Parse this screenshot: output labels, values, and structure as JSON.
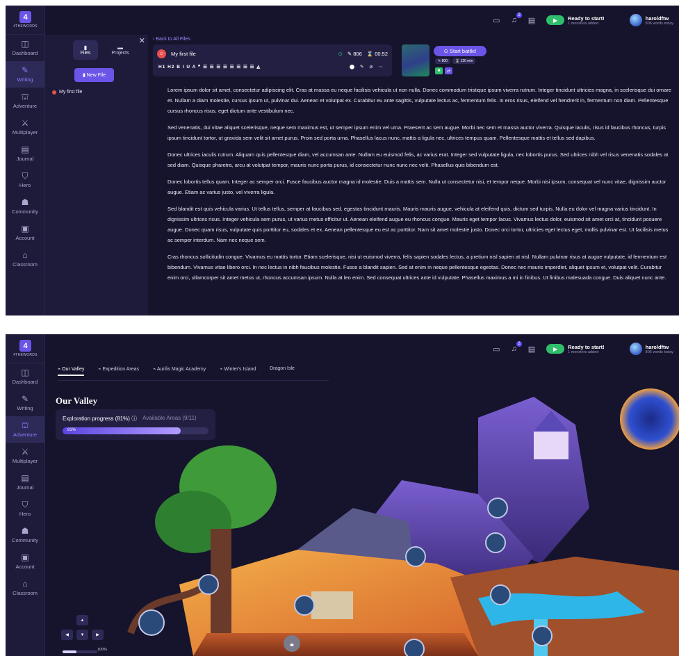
{
  "brand": {
    "logo_num": "4",
    "logo_text": "4THEWORDS"
  },
  "nav": [
    {
      "label": "Dashboard",
      "icon": "dashboard-icon"
    },
    {
      "label": "Writing",
      "icon": "pen-icon"
    },
    {
      "label": "Adventure",
      "icon": "adventure-icon"
    },
    {
      "label": "Multiplayer",
      "icon": "swords-icon"
    },
    {
      "label": "Journal",
      "icon": "journal-icon"
    },
    {
      "label": "Hero",
      "icon": "shield-icon"
    },
    {
      "label": "Community",
      "icon": "community-icon"
    },
    {
      "label": "Account",
      "icon": "account-icon"
    },
    {
      "label": "Classroom",
      "icon": "graduation-cap-icon"
    }
  ],
  "topbar": {
    "notif_count": "2",
    "ready_title": "Ready to start!",
    "ready_sub": "1 monsters added",
    "user_name": "haroldftw",
    "user_sub": "806 words today"
  },
  "files": {
    "tab_files": "Files",
    "tab_projects": "Projects",
    "new_file": "New File",
    "items": [
      "My first file"
    ]
  },
  "editor": {
    "back": "Back to All Files",
    "file_name": "My first file",
    "word_count": "806",
    "timer": "00:52",
    "battle_label": "Start battle!",
    "battle_words": "800",
    "battle_time": "120 min",
    "format_left": "H1 H2 B I U A ❞ ☰ ☰ ☰ ☰ ☰ ☰ ☰ ☰ ◭",
    "format_right": "⬤ ✎ ⊘ ⋯",
    "paragraphs": [
      "Lorem ipsum dolor sit amet, consectetur adipiscing elit. Cras at massa eu neque facilisis vehicula ut non nulla. Donec commodum tristique ipsum viverra rutrum. Integer tincidunt ultricies magna, in scelerisque dui ornare et. Nullam a diam molestie, cursus ipsum ut, pulvinar dui. Aenean et volutpat ex. Curabitur eu ante sagittis, vulputate lectus ac, fermentum felis. In eros risus, eleifend vel hendrerit in, fermentum non diam. Pellentesque cursus rhoncus risus, eget dictum ante vestibulum nec.",
      "Sed venenatis, dui vitae aliquet scelerisque, neque sem maximus est, ut semper ipsum enim vel urna. Praesent ac sem augue. Morbi nec sem et massa auctor viverra. Quisque iaculis, risus id faucibus rhoncus, turpis ipsum tincidunt tortor, ut gravida sem velit sit amet purus. Proin sed porta urna. Phasellus lacus nunc, mattis a ligula nec, ultrices tempus quam. Pellentesque mattis et tellus sed dapibus.",
      "Donec ultrices iaculis rutrum. Aliquam quis pellentesque diam, vel accumsan ante. Nullam eu euismod felis, ac varius erat. Integer sed vulputate ligula, nec lobortis purus. Sed ultrices nibh vel risus venenatis sodales at sed diam. Quisque pharetra, arcu at volutpat tempor, mauris nunc porta purus, id consectetur nunc nunc nec velit. Phasellus quis bibendum est.",
      "Donec lobortis tellus quam. Integer ac semper orci. Fusce faucibus auctor magna id molestie. Duis a mattis sem. Nulla ut consectetur nisi, et tempor neque. Morbi nisi ipsum, consequat vel nunc vitae, dignissim auctor augue. Etiam ac varius justo, vel viverra ligula.",
      "Sed blandit est quis vehicula varius. Ut tellus tellus, semper at faucibus sed, egestas tincidunt mauris. Mauris mauris augue, vehicula at eleifend quis, dictum sed turpis. Nulla eu dolor vel magna varius tincidunt. In dignissim ultrices risus. Integer vehicula sem purus, ut varius metus efficitur ut. Aenean eleifend augue eu rhoncus congue. Mauris eget tempor lacus. Vivamus lectus dolor, euismod sit amet orci at, tincidunt posuere augue. Donec quam risus, vulputate quis porttitor eu, sodales et ex. Aenean pellentesque eu est ac porttitor. Nam sit amet molestie justo. Donec orci tortor, ultricies eget lectus eget, mollis pulvinar est. Ut facilisis metus ac semper interdum. Nam nec neque sem.",
      "Cras rhoncus sollicitudin congue. Vivamus eu mattis tortor. Etiam scelerisque, nisi ut euismod viverra, felis sapien sodales lectus, a pretium nisl sapien at nisl. Nullam pulvinar risus at augue vulputate, id fermentum est bibendum. Vivamus vitae libero orci. In nec lectus in nibh faucibus molestie. Fusce a blandit sapien. Sed at enim in neque pellentesque egestas. Donec nec mauris imperdiet, aliquet ipsum et, volutpat velit. Curabitur enim orci, ullamcorper sit amet metus ut, rhoncus accumsan ipsum. Nulla at leo enim. Sed consequat ultrices ante id vulputate. Phasellus maximus a mi in finibus. Ut finibus malesuada congue. Duis aliquet nunc ante."
    ]
  },
  "adventure": {
    "tabs": [
      "Our Valley",
      "Expedition Areas",
      "Aurilis Magic Academy",
      "Winter's Island",
      "Dragon Isle"
    ],
    "title": "Our Valley",
    "progress_label": "Exploration progress (81%)",
    "areas_label": "Available Areas (9/11)",
    "progress_value": 81,
    "progress_text": "81%",
    "zoom_text": "100%"
  },
  "colors": {
    "bg": "#16142c",
    "panel": "#1e1b3a",
    "accent": "#6a55e8",
    "success": "#2fbf6b",
    "danger": "#e8504f"
  }
}
